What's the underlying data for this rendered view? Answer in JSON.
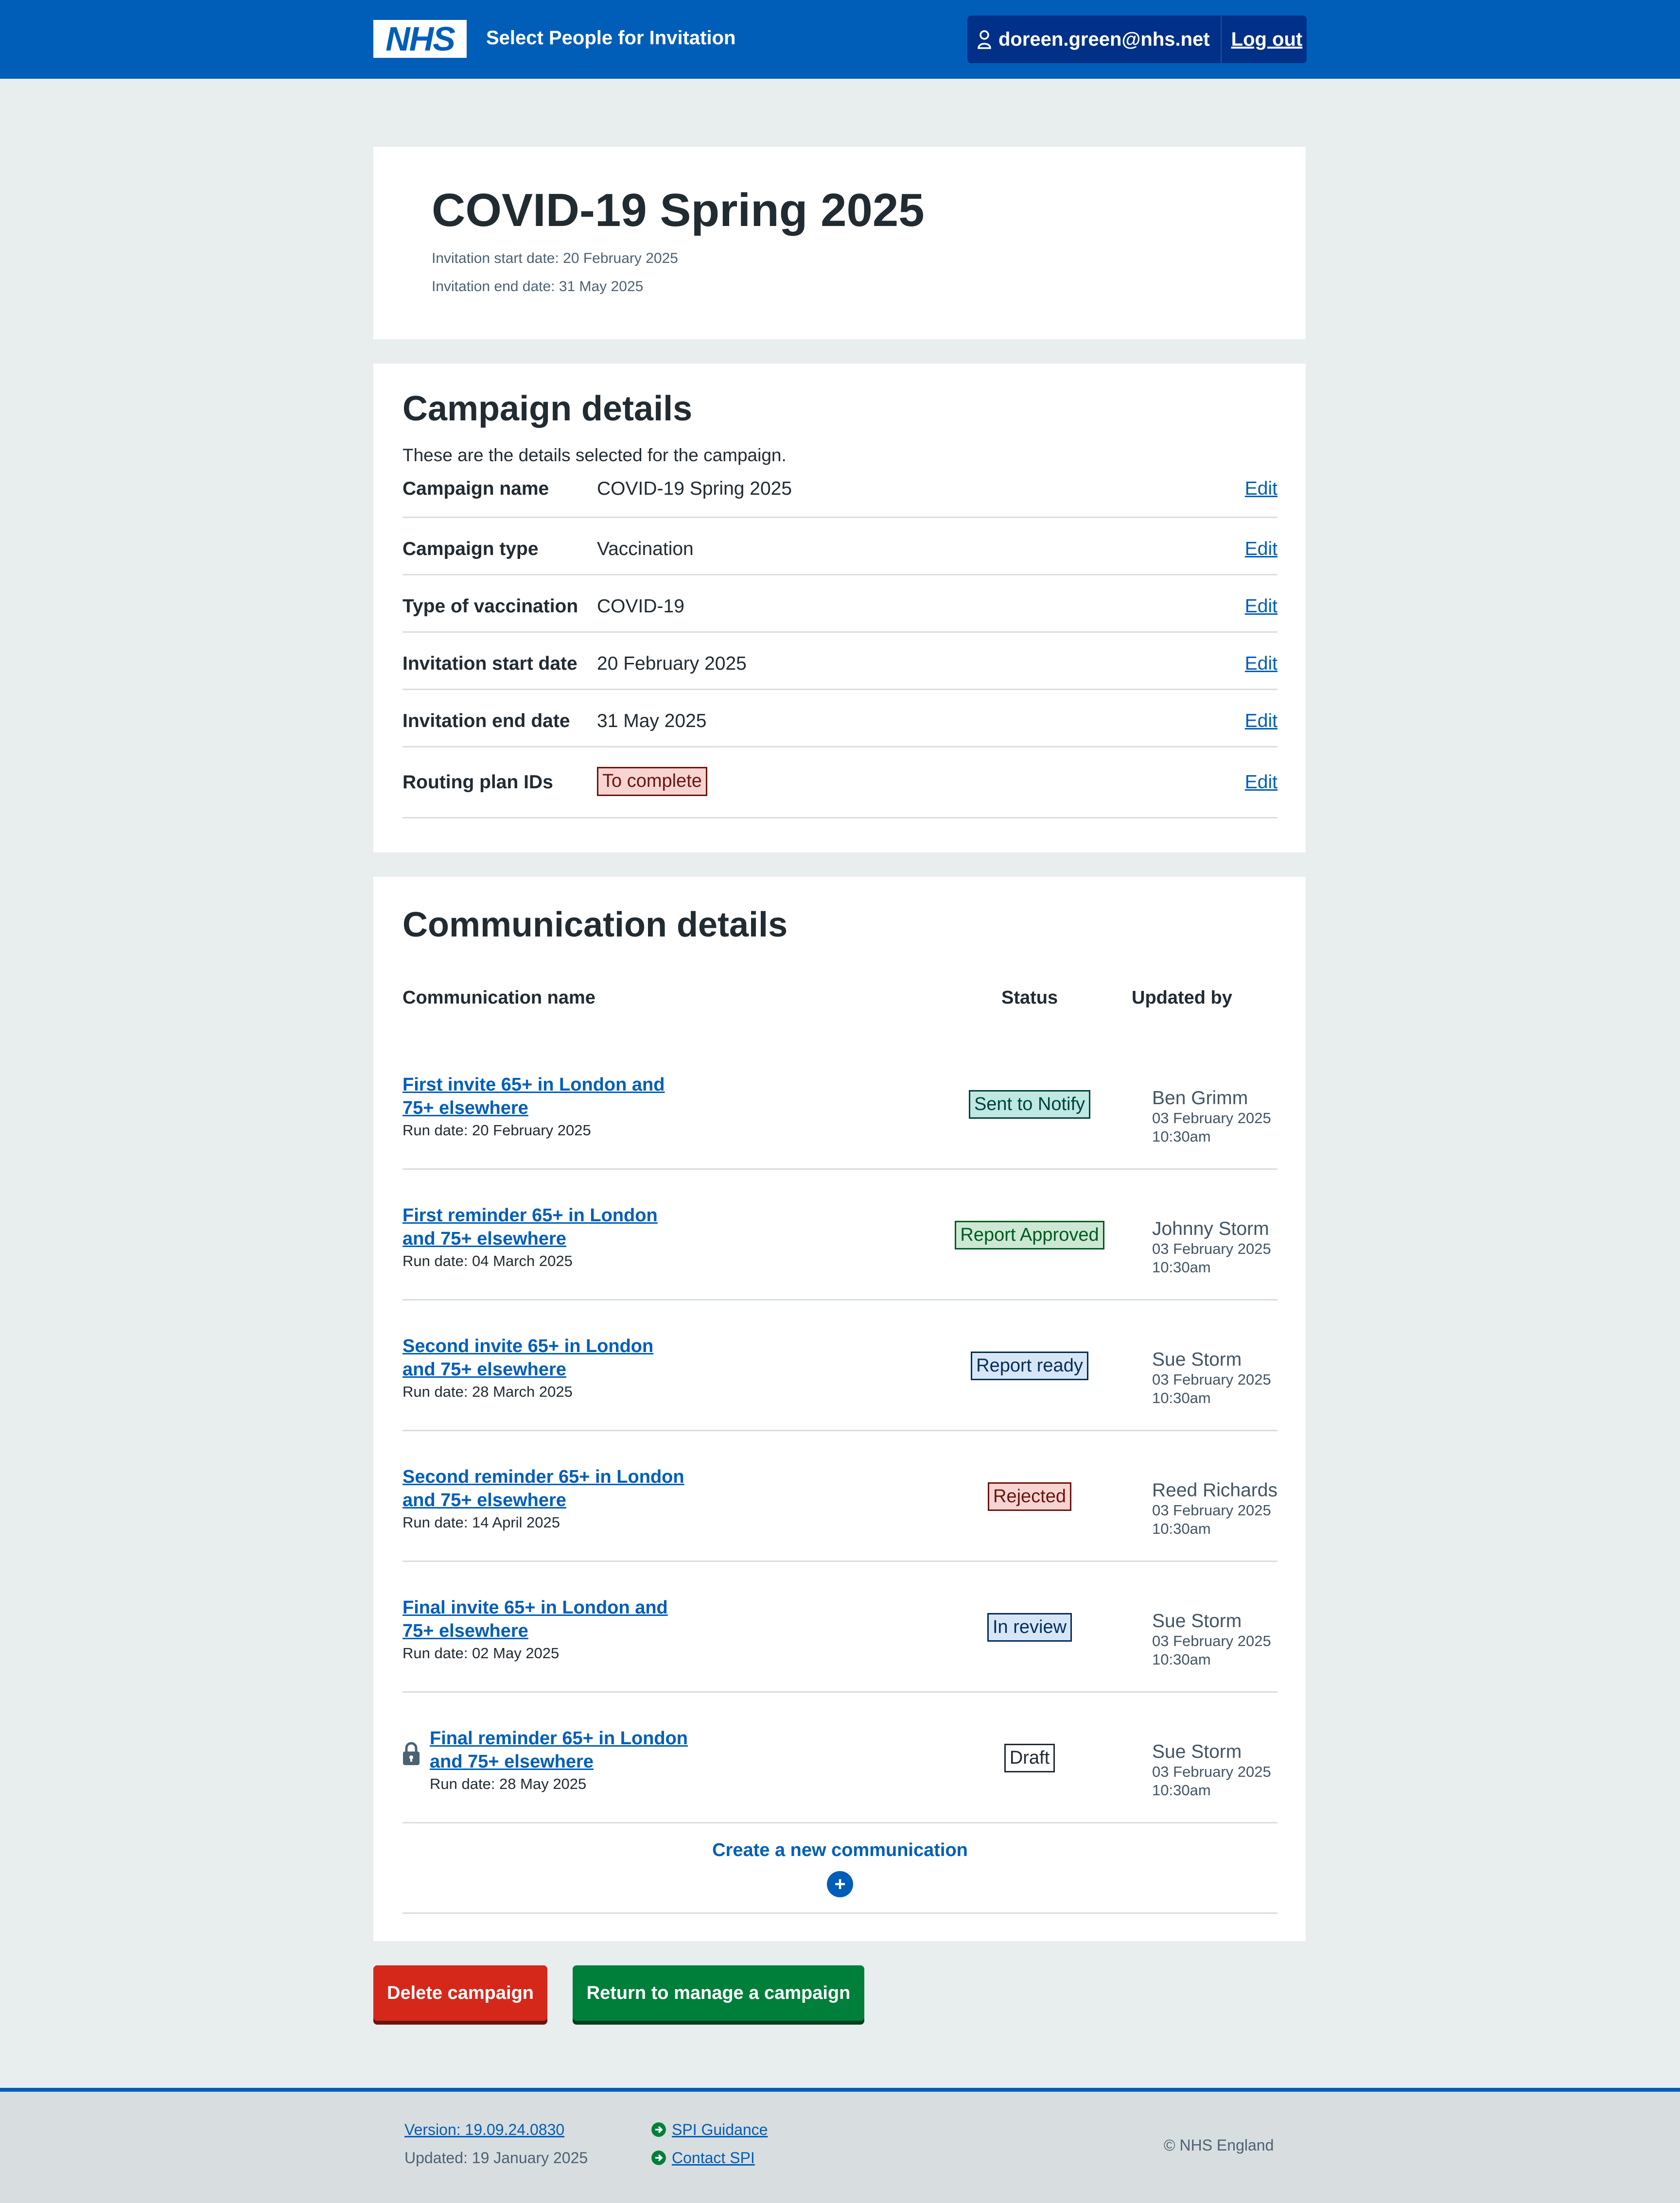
{
  "header": {
    "logo_text": "NHS",
    "service_name": "Select People for Invitation",
    "user_email": "doreen.green@nhs.net",
    "logout_label": "Log out"
  },
  "title_card": {
    "title": "COVID-19 Spring 2025",
    "start": "Invitation start date: 20 February 2025",
    "end": "Invitation end date: 31 May 2025"
  },
  "campaign": {
    "heading": "Campaign details",
    "lead": "These are the details selected for the campaign.",
    "edit_label": "Edit",
    "rows": [
      {
        "key": "Campaign name",
        "value": "COVID-19 Spring 2025"
      },
      {
        "key": "Campaign type",
        "value": "Vaccination"
      },
      {
        "key": "Type of vaccination",
        "value": "COVID-19"
      },
      {
        "key": "Invitation start date",
        "value": "20 February 2025"
      },
      {
        "key": "Invitation end date",
        "value": "31 May 2025"
      },
      {
        "key": "Routing plan IDs",
        "value": "To complete"
      }
    ]
  },
  "communications": {
    "heading": "Communication details",
    "columns": [
      "Communication name",
      "Status",
      "Updated by"
    ],
    "rows": [
      {
        "name": "First invite 65+ in London and 75+ elsewhere",
        "run": "Run date: 20 February 2025",
        "status": "Sent to Notify",
        "by": "Ben Grimm",
        "date": "03 February 2025",
        "time": "10:30am"
      },
      {
        "name": "First reminder 65+ in London and 75+ elsewhere",
        "run": "Run date: 04 March 2025",
        "status": "Report Approved",
        "by": "Johnny Storm",
        "date": "03 February 2025",
        "time": "10:30am"
      },
      {
        "name": "Second invite 65+ in London and 75+ elsewhere",
        "run": "Run date: 28 March 2025",
        "status": "Report ready",
        "by": "Sue Storm",
        "date": "03 February 2025",
        "time": "10:30am"
      },
      {
        "name": "Second reminder 65+ in London and 75+ elsewhere",
        "run": "Run date: 14 April 2025",
        "status": "Rejected",
        "by": "Reed Richards",
        "date": "03 February 2025",
        "time": "10:30am"
      },
      {
        "name": "Final invite 65+ in London and 75+ elsewhere",
        "run": "Run date: 02 May 2025",
        "status": "In review",
        "by": "Sue Storm",
        "date": "03 February 2025",
        "time": "10:30am"
      },
      {
        "name": "Final reminder 65+ in London and 75+ elsewhere",
        "run": "Run date: 28 May 2025",
        "status": "Draft",
        "by": "Sue Storm",
        "date": "03 February 2025",
        "time": "10:30am"
      }
    ],
    "create_label": "Create a new communication",
    "create_icon": "+"
  },
  "buttons": {
    "delete": "Delete campaign",
    "return": "Return to manage a campaign"
  },
  "footer": {
    "version": "Version: 19.09.24.0830",
    "updated": "Updated: 19 January 2025",
    "guidance": "SPI Guidance",
    "contact": "Contact SPI",
    "copyright": "© NHS England"
  },
  "colors": {
    "nhs_blue": "#005eb8",
    "dark_blue": "#003087",
    "red": "#d5281b",
    "green": "#007f3b",
    "page_bg": "#e8edee"
  }
}
